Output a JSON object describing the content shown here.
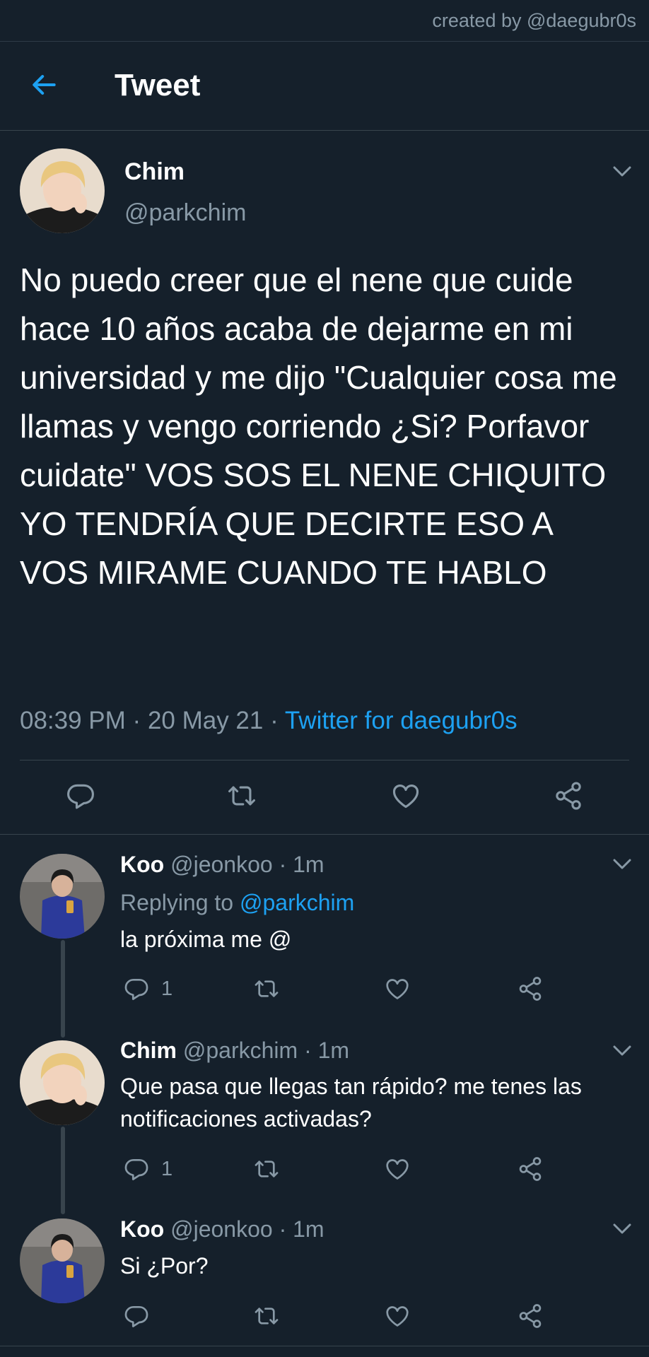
{
  "watermark": "created by @daegubr0s",
  "header": {
    "title": "Tweet"
  },
  "tweet": {
    "author_name": "Chim",
    "author_handle": "@parkchim",
    "text": "No puedo creer que el nene que cuide hace 10 años acaba de dejarme en mi universidad y me dijo \"Cualquier cosa me llamas y vengo corriendo ¿Si? Porfavor cuidate\" VOS SOS EL NENE CHIQUITO YO TENDRÍA QUE DECIRTE ESO A VOS MIRAME CUANDO TE HABLO",
    "time": "08:39 PM",
    "date": "20 May 21",
    "sep": "·",
    "source": "Twitter for daegubr0s"
  },
  "replies": [
    {
      "name": "Koo",
      "handle": "@jeonkoo",
      "time": "1m",
      "sep": "·",
      "replying_label": "Replying to",
      "replying_to": "@parkchim",
      "text": "la próxima me @",
      "reply_count": "1"
    },
    {
      "name": "Chim",
      "handle": "@parkchim",
      "time": "1m",
      "sep": "·",
      "text": "Que pasa que llegas tan rápido? me tenes las notificaciones activadas?",
      "reply_count": "1"
    },
    {
      "name": "Koo",
      "handle": "@jeonkoo",
      "time": "1m",
      "sep": "·",
      "text": "Si ¿Por?"
    }
  ],
  "icons": [
    "back-arrow-icon",
    "chevron-down-icon",
    "reply-icon",
    "retweet-icon",
    "like-icon",
    "share-icon"
  ],
  "colors": {
    "background": "#15202b",
    "accent": "#1da1f2",
    "muted": "#8899a6",
    "divider": "#38444d"
  }
}
